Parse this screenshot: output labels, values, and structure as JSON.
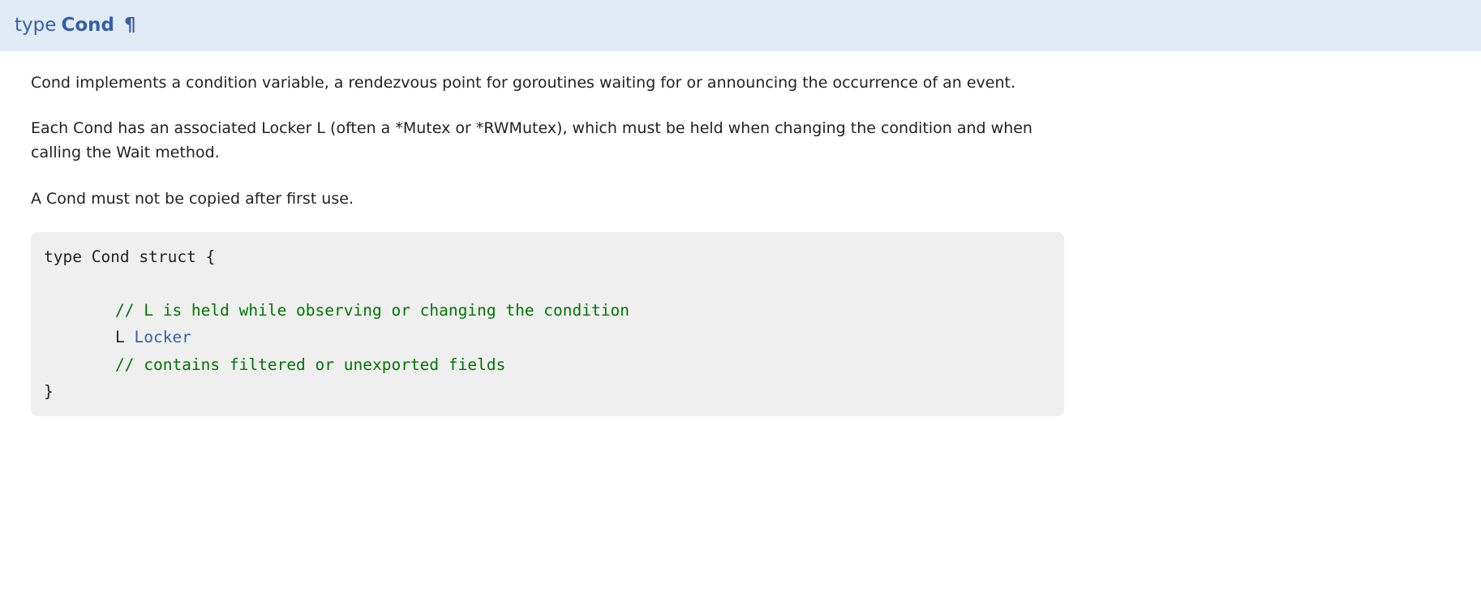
{
  "header": {
    "keyword": "type",
    "name": "Cond",
    "pilcrow": "¶"
  },
  "paragraphs": [
    "Cond implements a condition variable, a rendezvous point for goroutines waiting for or announcing the occurrence of an event.",
    "Each Cond has an associated Locker L (often a *Mutex or *RWMutex), which must be held when changing the condition and when calling the Wait method.",
    "A Cond must not be copied after first use."
  ],
  "code": {
    "line1": "type Cond struct {",
    "blank": "",
    "comment1": "// L is held while observing or changing the condition",
    "field_name": "L ",
    "field_type": "Locker",
    "comment2": "// contains filtered or unexported fields",
    "close": "}"
  }
}
